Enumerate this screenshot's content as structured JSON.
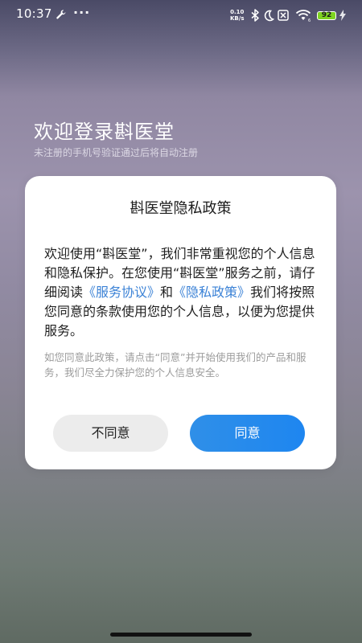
{
  "status_bar": {
    "time": "10:37",
    "net_speed_value": "0.10",
    "net_speed_unit": "KB/s",
    "battery_level": "92",
    "icons": [
      "wrench-icon",
      "more-icon",
      "bluetooth-icon",
      "moon-icon",
      "sim-error-icon",
      "wifi-icon",
      "battery-icon",
      "charging-icon"
    ],
    "battery_color": "#7ed321"
  },
  "login": {
    "title": "欢迎登录斟医堂",
    "subtitle": "未注册的手机号验证通过后将自动注册"
  },
  "dialog": {
    "title": "斟医堂隐私政策",
    "body_part1": "欢迎使用“斟医堂”，我们非常重视您的个人信息和隐私保护。在您使用“斟医堂”服务之前，请仔细阅读",
    "link_service_agreement": "《服务协议》",
    "body_and": "和",
    "link_privacy_policy": "《隐私政策》",
    "body_part2": "我们将按照您同意的条款使用您的个人信息，以便为您提供服务。",
    "note": "如您同意此政策，请点击“同意”并开始使用我们的产品和服务，我们尽全力保护您的个人信息安全。",
    "decline_label": "不同意",
    "agree_label": "同意",
    "link_color": "#3b82d6",
    "agree_color": "#2f8fe8"
  }
}
